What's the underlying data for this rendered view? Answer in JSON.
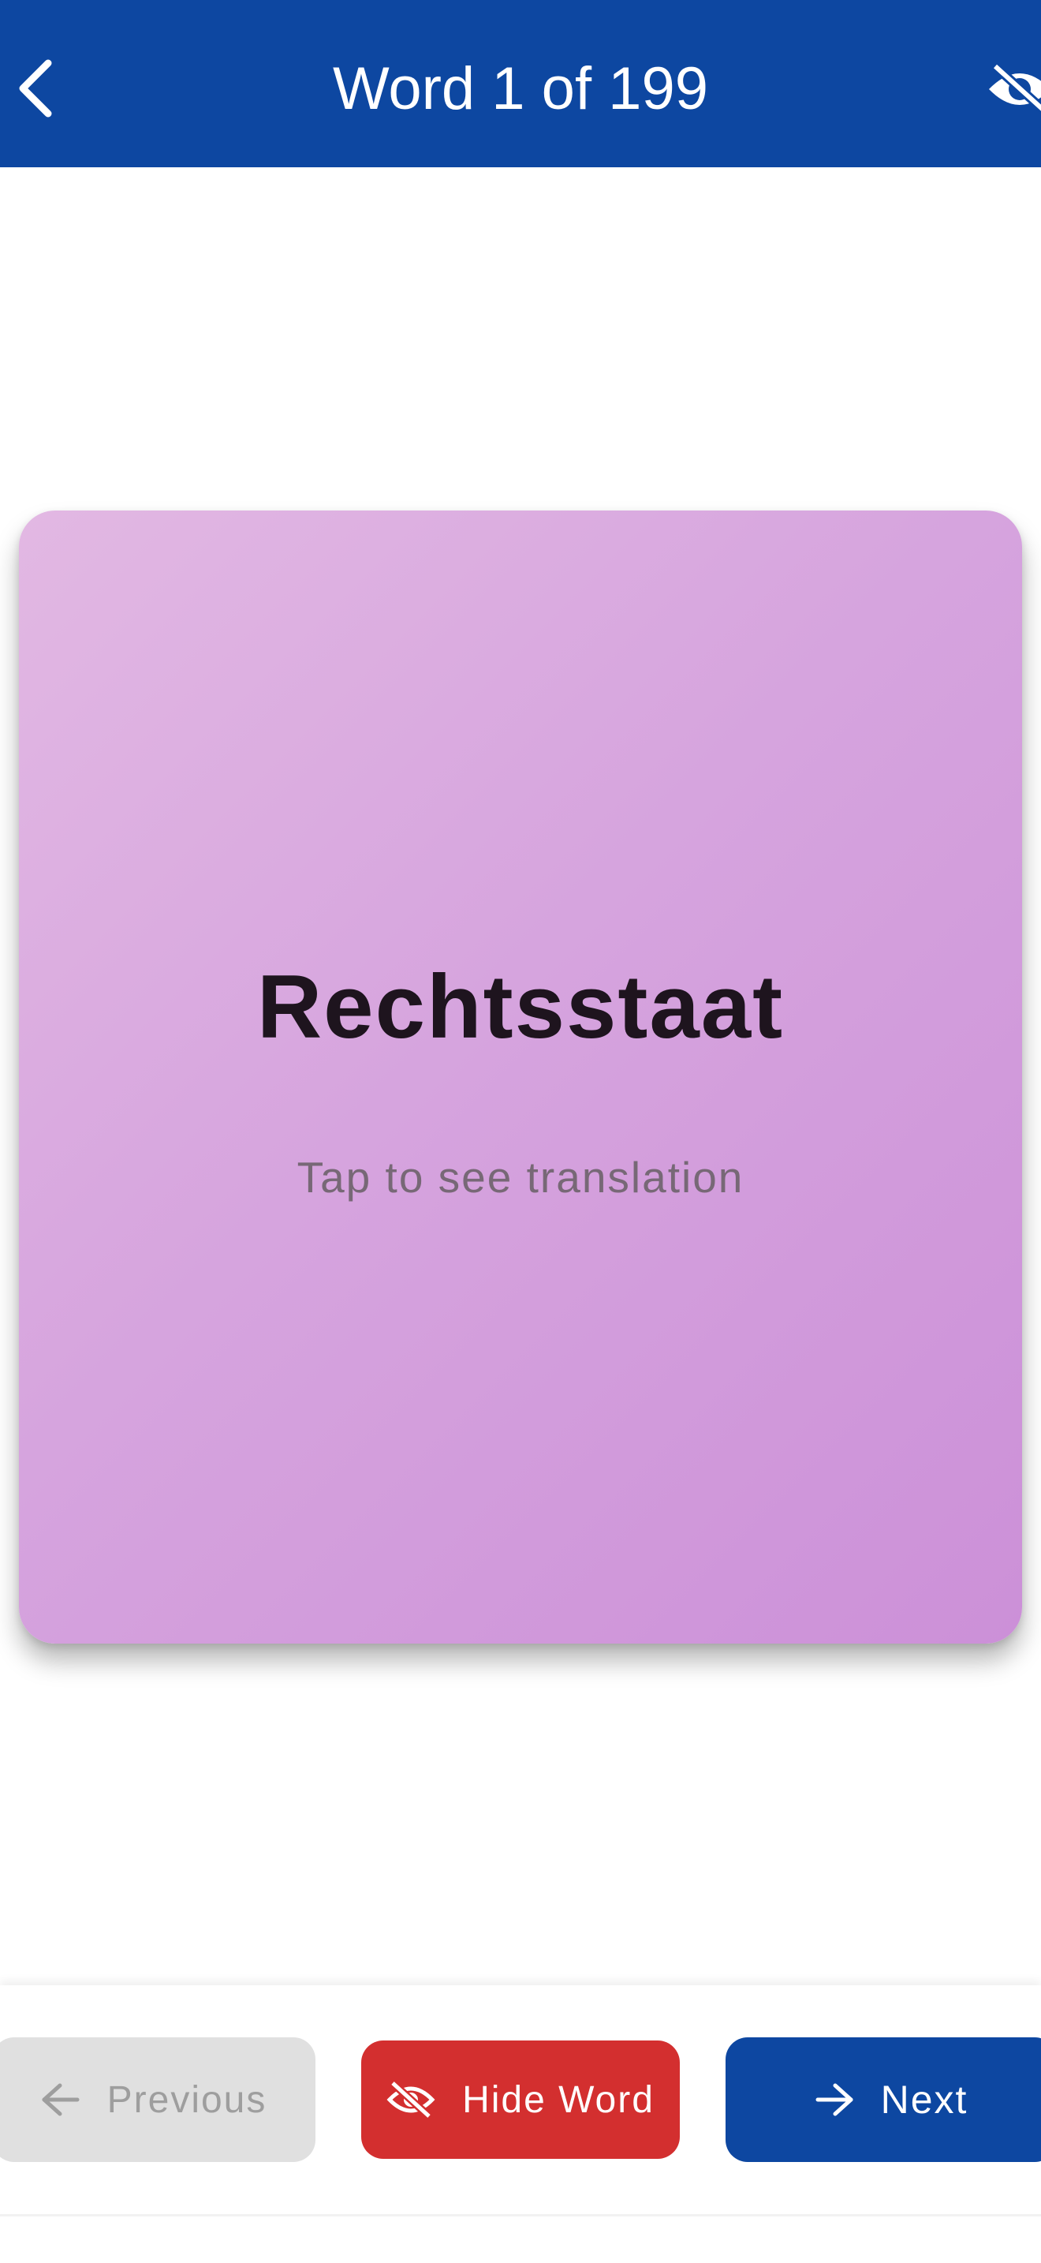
{
  "app_bar": {
    "title": "Word 1 of 199",
    "back_icon": "chevron-left-icon",
    "visibility_icon": "eye-off-icon"
  },
  "card": {
    "word": "Rechtsstaat",
    "hint": "Tap to see translation"
  },
  "actions": {
    "previous_label": "Previous",
    "hide_label": "Hide Word",
    "next_label": "Next"
  },
  "colors": {
    "primary": "#0d47a1",
    "danger": "#d32f2f",
    "disabled": "#e0e0e0",
    "card_gradient_start": "#e2b8e3",
    "card_gradient_end": "#cc90d8"
  }
}
